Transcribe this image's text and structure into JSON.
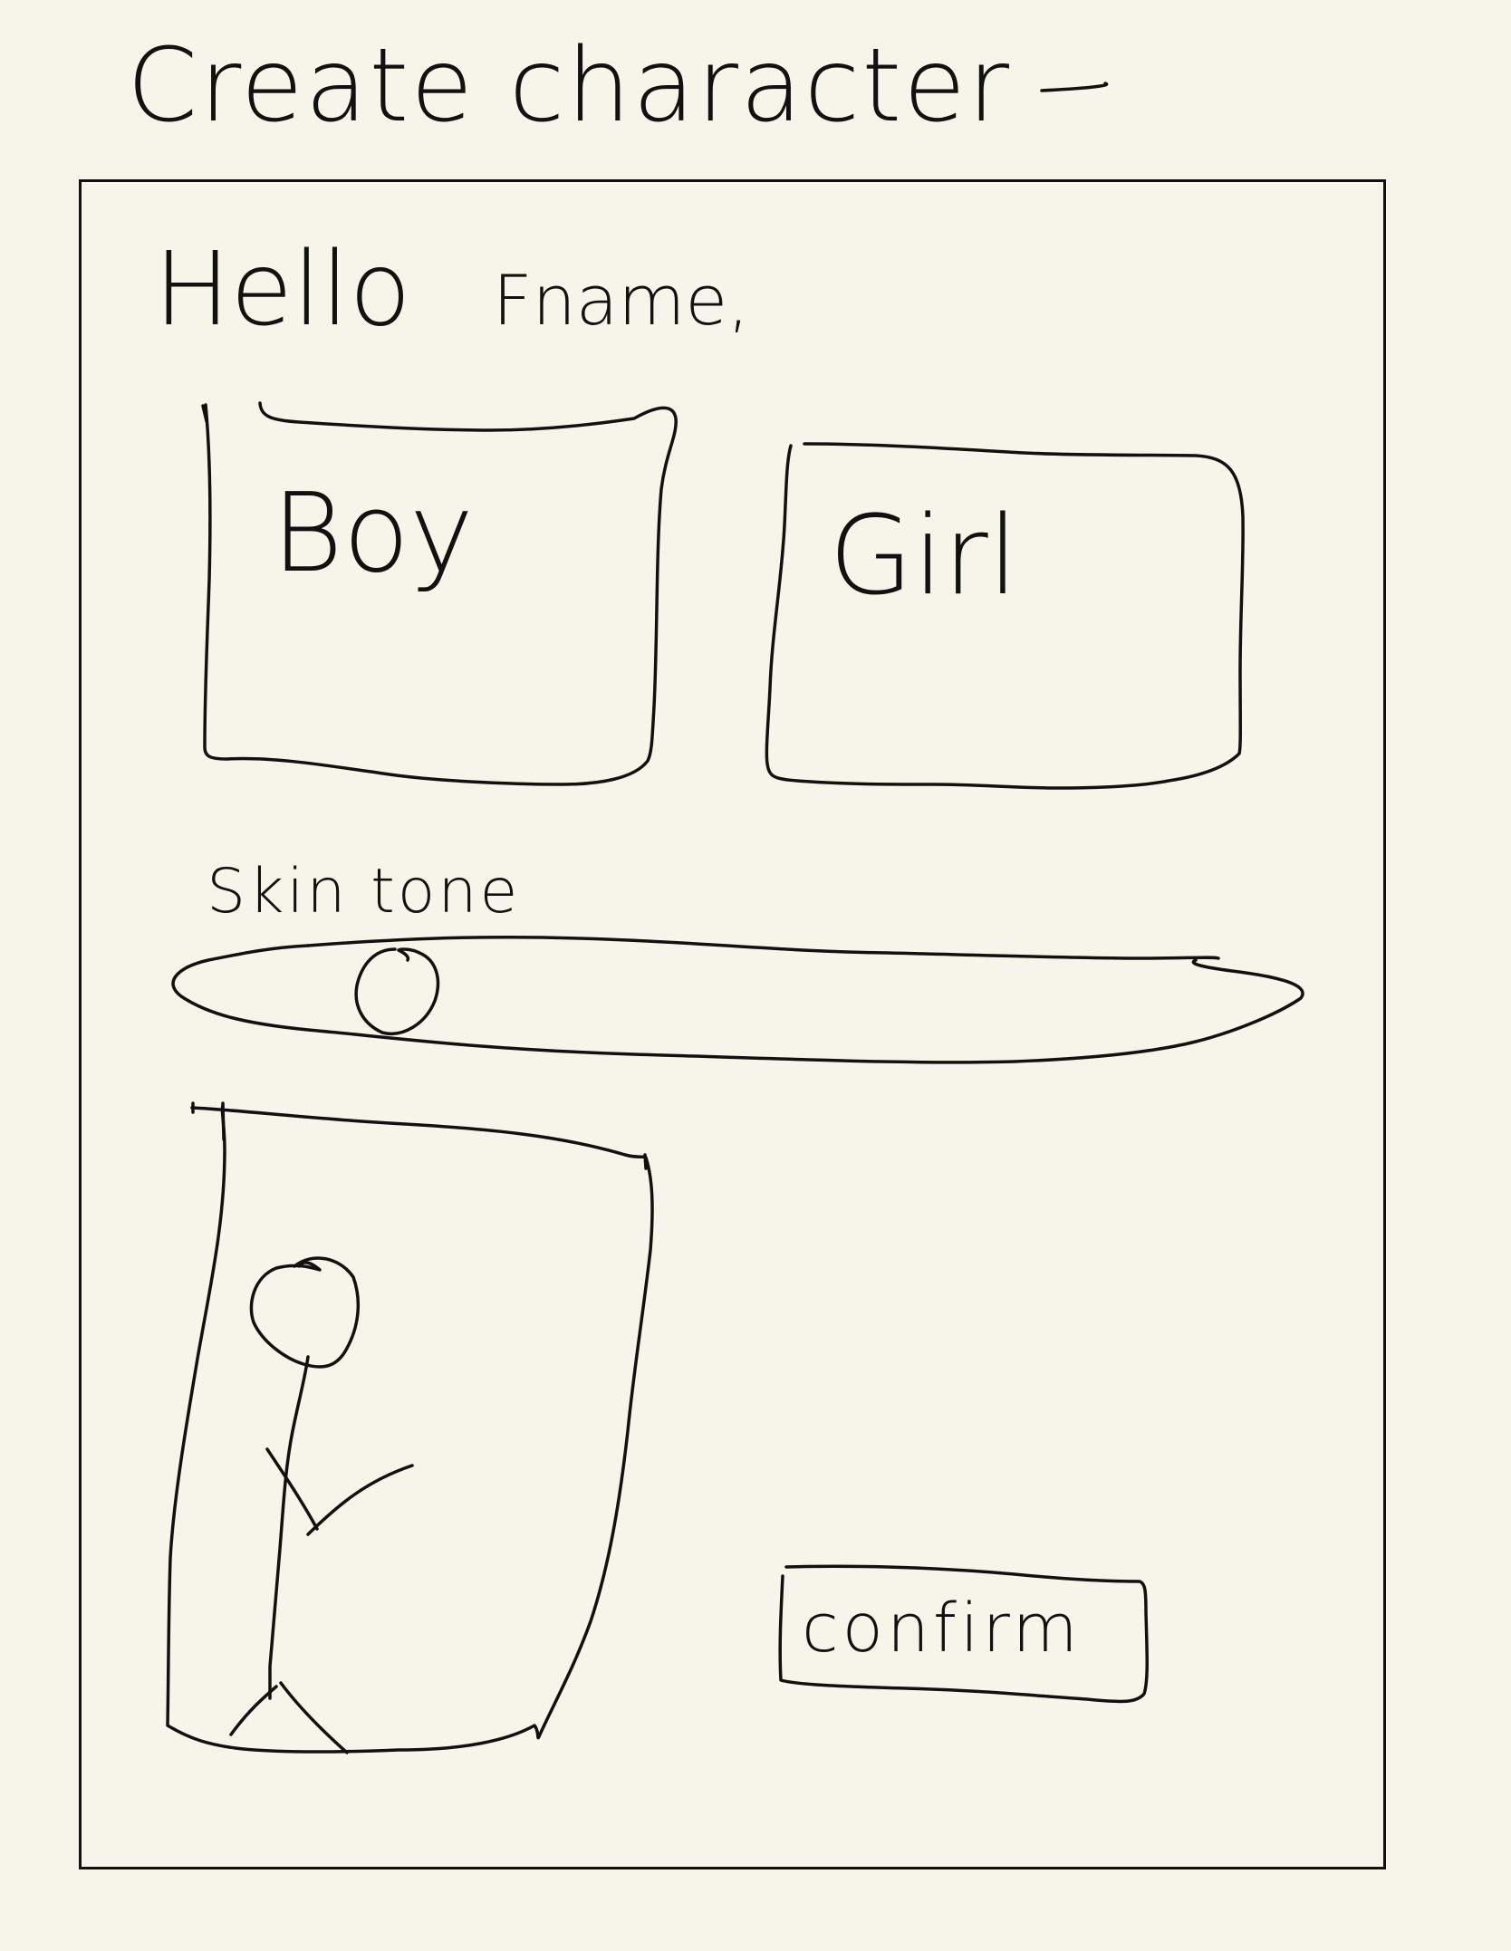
{
  "page": {
    "title": "Create character"
  },
  "greeting": {
    "hello": "Hello",
    "name": "Fname,"
  },
  "gender": {
    "boy_label": "Boy",
    "girl_label": "Girl"
  },
  "skin_tone": {
    "label": "Skin tone",
    "value": 0.18
  },
  "preview": {
    "figure_icon": "stick-figure-icon"
  },
  "actions": {
    "confirm_label": "confirm"
  },
  "colors": {
    "background": "#f7f5ea",
    "ink": "#111111"
  }
}
